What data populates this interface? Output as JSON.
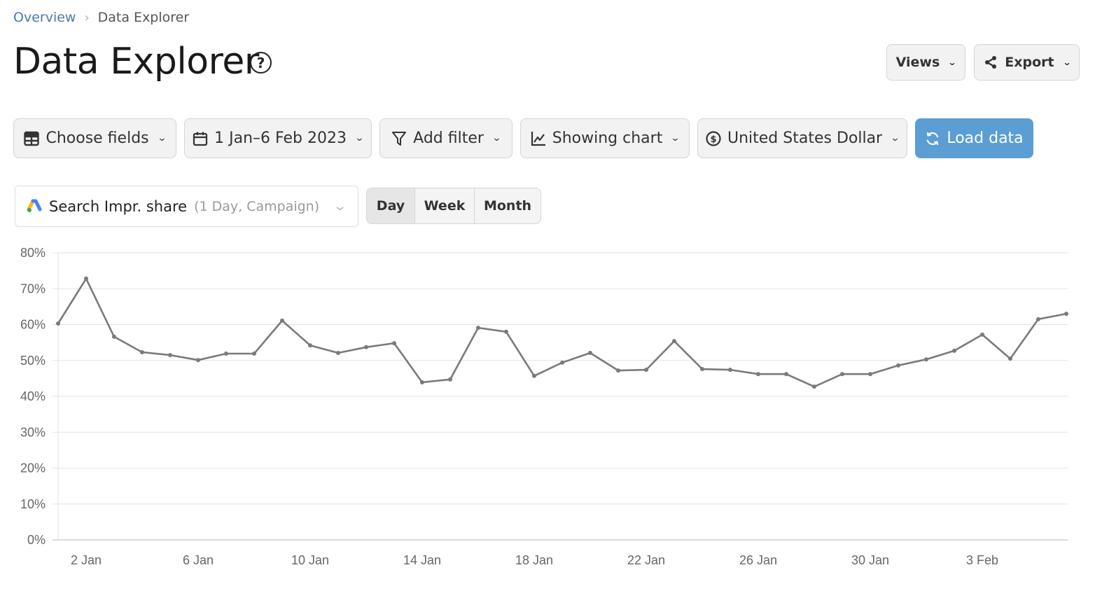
{
  "breadcrumb": {
    "parent": "Overview",
    "separator": "›",
    "current": "Data Explorer"
  },
  "header": {
    "title": "Data Explorer",
    "help_icon": "?",
    "views_label": "Views",
    "export_label": "Export"
  },
  "toolbar": {
    "choose_fields": "Choose fields",
    "date_range": "1 Jan–6 Feb 2023",
    "add_filter": "Add filter",
    "display_mode": "Showing chart",
    "currency": "United States Dollar",
    "load_data": "Load data"
  },
  "metric": {
    "name": "Search Impr. share",
    "detail": "(1 Day, Campaign)"
  },
  "granularity": {
    "options": [
      "Day",
      "Week",
      "Month"
    ],
    "selected": "Day"
  },
  "colors": {
    "accent": "#5b9ed3",
    "link": "#4a79a8",
    "series": "#7a7a7a",
    "grid": "#e2e2e2"
  },
  "chart_data": {
    "type": "line",
    "title": "",
    "xlabel": "",
    "ylabel": "",
    "ylim": [
      0,
      80
    ],
    "y_ticks": [
      0,
      10,
      20,
      30,
      40,
      50,
      60,
      70,
      80
    ],
    "y_tick_labels": [
      "0%",
      "10%",
      "20%",
      "30%",
      "40%",
      "50%",
      "60%",
      "70%",
      "80%"
    ],
    "x_tick_labels": [
      {
        "index": 1,
        "label": "2 Jan"
      },
      {
        "index": 5,
        "label": "6 Jan"
      },
      {
        "index": 9,
        "label": "10 Jan"
      },
      {
        "index": 13,
        "label": "14 Jan"
      },
      {
        "index": 17,
        "label": "18 Jan"
      },
      {
        "index": 21,
        "label": "22 Jan"
      },
      {
        "index": 25,
        "label": "26 Jan"
      },
      {
        "index": 29,
        "label": "30 Jan"
      },
      {
        "index": 33,
        "label": "3 Feb"
      }
    ],
    "grid": true,
    "legend": "none",
    "x": [
      "1 Jan",
      "2 Jan",
      "3 Jan",
      "4 Jan",
      "5 Jan",
      "6 Jan",
      "7 Jan",
      "8 Jan",
      "9 Jan",
      "10 Jan",
      "11 Jan",
      "12 Jan",
      "13 Jan",
      "14 Jan",
      "15 Jan",
      "16 Jan",
      "17 Jan",
      "18 Jan",
      "19 Jan",
      "20 Jan",
      "21 Jan",
      "22 Jan",
      "23 Jan",
      "24 Jan",
      "25 Jan",
      "26 Jan",
      "27 Jan",
      "28 Jan",
      "29 Jan",
      "30 Jan",
      "31 Jan",
      "1 Feb",
      "2 Feb",
      "3 Feb",
      "4 Feb",
      "5 Feb",
      "6 Feb"
    ],
    "series": [
      {
        "name": "Search Impr. share",
        "unit": "%",
        "values": [
          60.3,
          72.8,
          56.6,
          52.3,
          51.5,
          50.1,
          51.9,
          51.9,
          61.1,
          54.2,
          52.1,
          53.7,
          54.8,
          43.9,
          44.7,
          59.1,
          58.0,
          45.7,
          49.4,
          52.1,
          47.2,
          47.4,
          55.4,
          47.6,
          47.4,
          46.2,
          46.2,
          42.7,
          46.2,
          46.2,
          48.6,
          50.3,
          52.7,
          57.2,
          50.5,
          61.5,
          63.0
        ]
      }
    ]
  }
}
